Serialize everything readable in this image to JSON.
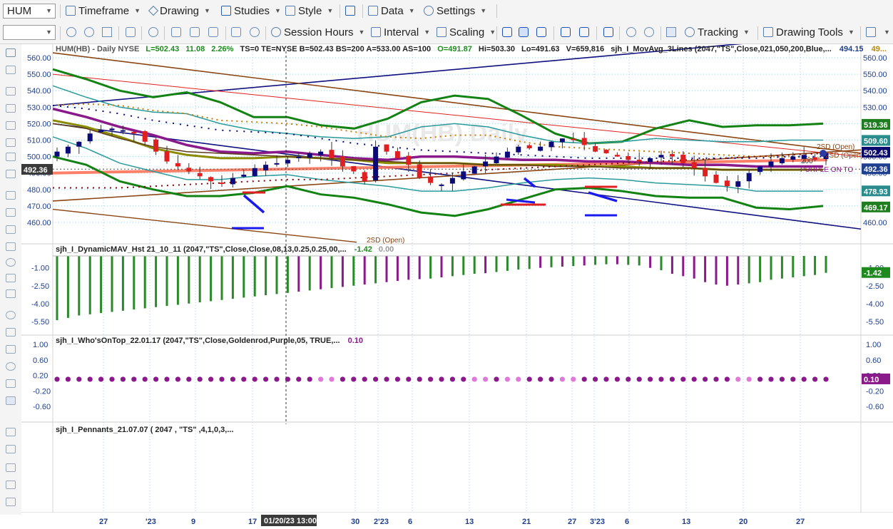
{
  "toolbar1": {
    "symbol": "HUM",
    "timeframe": "Timeframe",
    "drawing": "Drawing",
    "studies": "Studies",
    "style": "Style",
    "data": "Data",
    "settings": "Settings"
  },
  "toolbar2": {
    "session_hours": "Session Hours",
    "interval": "Interval",
    "scaling": "Scaling",
    "tracking": "Tracking",
    "drawing_tools": "Drawing Tools"
  },
  "price_pane": {
    "header": {
      "sym": "HUM(HB) - Daily  NYSE",
      "last": "L=502.43",
      "chg": "11.08",
      "pct": "2.26%",
      "rest": "TS=0  TE=NYSE  B=502.43  BS=200  A=533.00  AS=100",
      "open": "O=491.87",
      "hi": "Hi=503.30",
      "lo": "Lo=491.63",
      "vol": "V=659,816",
      "study": "sjh_I_MovAvg_3Lines (2047,\"TS\",Close,021,050,200,Blue,...",
      "study_v1": "494.15",
      "study_v2": "49..."
    },
    "watermark": "HUM(HB) Daily",
    "crosshair_price": "492.36",
    "axis_ticks": [
      "560.00",
      "550.00",
      "540.00",
      "530.00",
      "520.00",
      "510.00",
      "500.00",
      "490.00",
      "480.00",
      "470.00",
      "460.00"
    ],
    "right_tags": [
      {
        "text": "519.36",
        "color": "#1e7d1e"
      },
      {
        "text": "509.60",
        "color": "#2a8c8c"
      },
      {
        "text": "502.43",
        "color": "#0a0a6e"
      },
      {
        "text": "492.36",
        "color": "#1f3f8f"
      },
      {
        "text": "478.93",
        "color": "#2a8c8c"
      },
      {
        "text": "469.17",
        "color": "#1e7d1e"
      }
    ],
    "labels": {
      "sd_open_upper1": "2SD (Open)",
      "sd_open_upper2": "2SD (Open)",
      "sd_open_lower": "2SD (Open)",
      "purple_on_top": "PURPLE ON TO",
      "two_hundred": "200"
    }
  },
  "dmav_pane": {
    "header": "sjh_I_DynamicMAV_Hst 21_10_11 (2047,\"TS\",Close,Close,08,13,0.25,0.25,00,...",
    "value1": "-1.42",
    "value2": "0.00",
    "ticks": [
      "-1.00",
      "-2.50",
      "-4.00",
      "-5.50"
    ],
    "right_ticks": [
      "-1.00",
      "-2.50",
      "-4.00",
      "-5.50"
    ],
    "tag": "-1.42",
    "histogram": [
      -5.4,
      -5.2,
      -5.0,
      -4.9,
      -4.8,
      -4.7,
      -4.6,
      -4.5,
      -4.4,
      -4.3,
      -4.2,
      -4.1,
      -4.0,
      -3.9,
      -3.8,
      -3.7,
      -3.6,
      -3.5,
      -3.4,
      -3.3,
      -3.2,
      -3.1,
      -3.0,
      -2.9,
      -2.8,
      -2.7,
      -2.6,
      -2.5,
      -2.4,
      -2.3,
      -2.2,
      -2.1,
      -2.0,
      -1.95,
      -1.9,
      -1.8,
      -1.7,
      -1.6,
      -1.5,
      -1.45,
      -1.35,
      -1.25,
      -1.15,
      -1.1,
      -1.0,
      -0.95,
      -0.9,
      -0.85,
      -0.8,
      -0.75,
      -0.7,
      -0.7,
      -0.75,
      -0.8,
      -1.0,
      -1.2,
      -1.5,
      -1.7,
      -1.9,
      -2.2,
      -2.4,
      -2.5,
      -2.4,
      -2.3,
      -2.2,
      -2.0,
      -1.9,
      -1.8,
      -1.7,
      -1.6,
      -1.42
    ],
    "purple_bars": [
      22,
      24,
      26,
      28,
      30,
      31,
      32,
      33,
      35,
      39,
      44,
      46,
      48,
      51,
      54,
      56,
      57,
      58,
      59,
      60,
      61,
      62
    ]
  },
  "wot_pane": {
    "header": "sjh_I_Who'sOnTop_22.01.17 (2047,\"TS\",Close,Goldenrod,Purple,05, TRUE,...",
    "value": "0.10",
    "ticks": [
      "1.00",
      "0.60",
      "0.20",
      "-0.20",
      "-0.60"
    ],
    "right_ticks": [
      "1.00",
      "0.60",
      "0.20",
      "-0.20",
      "-0.60"
    ],
    "tag": "0.10",
    "dot_value": 0.1,
    "light_dots": [
      24,
      25,
      38,
      39,
      41,
      42,
      46,
      47,
      62,
      63
    ]
  },
  "pennants_pane": {
    "header": "sjh_I_Pennants_21.07.07 ( 2047 , \"TS\" ,4,1,0,3,..."
  },
  "time_axis": {
    "labels": [
      "27",
      "'23",
      "9",
      "17",
      "30",
      "2'23",
      "6",
      "13",
      "21",
      "27",
      "3'23",
      "6",
      "13",
      "20",
      "27"
    ],
    "crosshair_time": "01/20/23 13:00"
  },
  "colors": {
    "axis_text": "#1f3f8f",
    "up_candle": "#0a0a7a",
    "down_candle": "#e02020",
    "green_hist": "#2a8a2a",
    "purple": "#8a1a8a"
  }
}
